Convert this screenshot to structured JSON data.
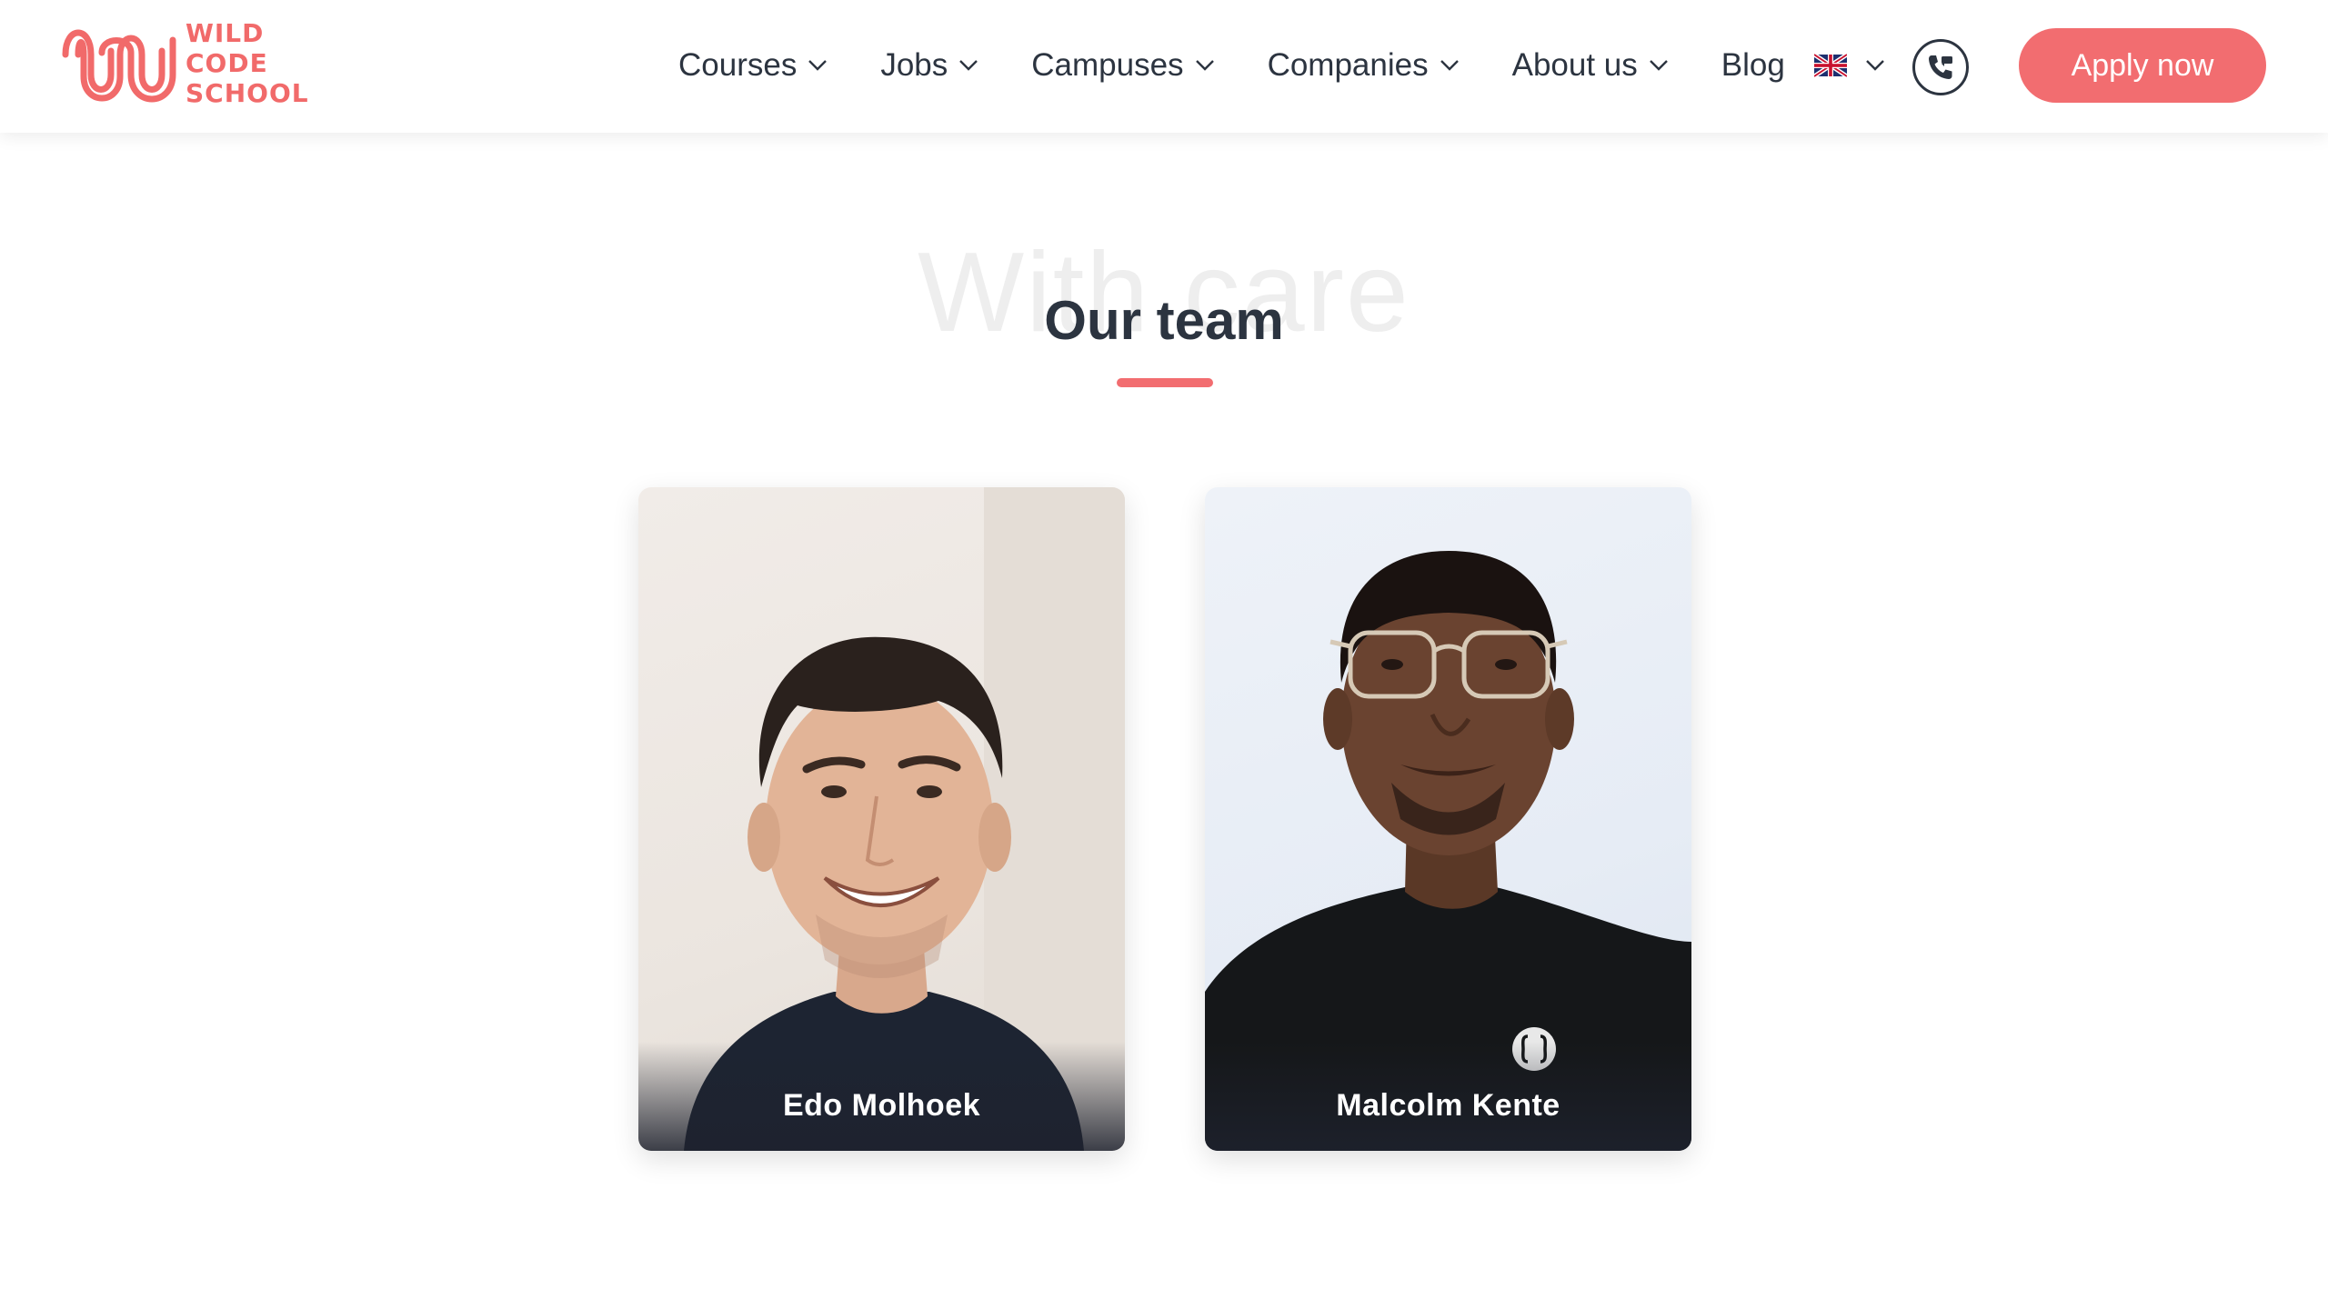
{
  "brand": {
    "logo_lines": [
      "WILD",
      "CODE",
      "SCHOOL"
    ],
    "accent_color": "#f26d70"
  },
  "nav": {
    "items": [
      {
        "label": "Courses",
        "has_dropdown": true
      },
      {
        "label": "Jobs",
        "has_dropdown": true
      },
      {
        "label": "Campuses",
        "has_dropdown": true
      },
      {
        "label": "Companies",
        "has_dropdown": true
      },
      {
        "label": "About us",
        "has_dropdown": true
      },
      {
        "label": "Blog",
        "has_dropdown": false
      }
    ],
    "language_icon": "uk-flag-icon",
    "phone_icon": "phone-icon",
    "apply_label": "Apply now"
  },
  "section": {
    "background_word": "With care",
    "title": "Our team"
  },
  "team": [
    {
      "name": "Edo Molhoek"
    },
    {
      "name": "Malcolm Kente"
    }
  ]
}
